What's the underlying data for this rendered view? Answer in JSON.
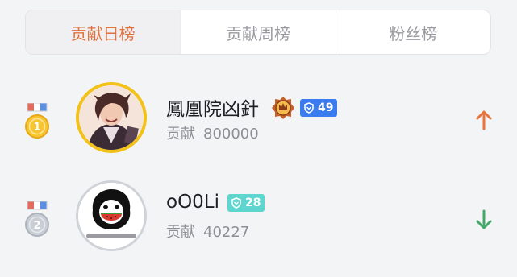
{
  "tabs": [
    {
      "label": "贡献日榜",
      "active": true
    },
    {
      "label": "贡献周榜",
      "active": false
    },
    {
      "label": "粉丝榜",
      "active": false
    }
  ],
  "rankings": [
    {
      "rank": "1",
      "medal": "gold-medal-icon",
      "name": "鳳凰院凶針",
      "contribution_label": "贡献",
      "contribution_value": "800000",
      "level": "49",
      "level_color": "#3b7bf0",
      "trend": "up",
      "trend_color": "#e9733d"
    },
    {
      "rank": "2",
      "medal": "silver-medal-icon",
      "name": "oO0Li",
      "contribution_label": "贡献",
      "contribution_value": "40227",
      "level": "28",
      "level_color": "#5ed6cf",
      "trend": "down",
      "trend_color": "#45a86a"
    }
  ],
  "colors": {
    "accent": "#e2713c",
    "gold": "#f2c21a"
  }
}
